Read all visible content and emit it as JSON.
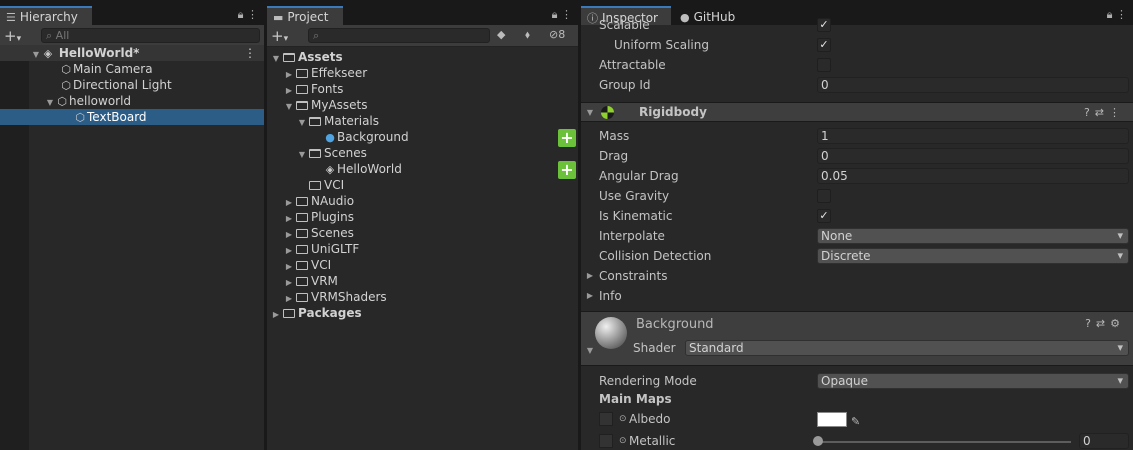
{
  "hierarchy": {
    "tab_label": "Hierarchy",
    "search_placeholder": "All",
    "scene_name": "HelloWorld*",
    "items": [
      {
        "label": "Main Camera"
      },
      {
        "label": "Directional Light"
      },
      {
        "label": "helloworld"
      },
      {
        "label": "TextBoard"
      }
    ]
  },
  "project": {
    "tab_label": "Project",
    "hidden_count": "8",
    "tree": [
      {
        "label": "Assets"
      },
      {
        "label": "Effekseer"
      },
      {
        "label": "Fonts"
      },
      {
        "label": "MyAssets"
      },
      {
        "label": "Materials"
      },
      {
        "label": "Background"
      },
      {
        "label": "Scenes"
      },
      {
        "label": "HelloWorld"
      },
      {
        "label": "VCI"
      },
      {
        "label": "NAudio"
      },
      {
        "label": "Plugins"
      },
      {
        "label": "Scenes"
      },
      {
        "label": "UniGLTF"
      },
      {
        "label": "VCI"
      },
      {
        "label": "VRM"
      },
      {
        "label": "VRMShaders"
      },
      {
        "label": "Packages"
      }
    ]
  },
  "inspector": {
    "tab_label": "Inspector",
    "github_tab_label": "GitHub",
    "top_rows": {
      "scalable": "Scalable",
      "uniform_scaling": "Uniform Scaling",
      "attractable": "Attractable",
      "group_id": "Group Id",
      "group_id_value": "0"
    },
    "rigidbody": {
      "title": "Rigidbody",
      "mass_label": "Mass",
      "mass_value": "1",
      "drag_label": "Drag",
      "drag_value": "0",
      "angular_drag_label": "Angular Drag",
      "angular_drag_value": "0.05",
      "use_gravity_label": "Use Gravity",
      "is_kinematic_label": "Is Kinematic",
      "interpolate_label": "Interpolate",
      "interpolate_value": "None",
      "collision_label": "Collision Detection",
      "collision_value": "Discrete",
      "constraints_label": "Constraints",
      "info_label": "Info"
    },
    "material": {
      "name": "Background",
      "shader_label": "Shader",
      "shader_value": "Standard",
      "rendering_mode_label": "Rendering Mode",
      "rendering_mode_value": "Opaque",
      "main_maps_label": "Main Maps",
      "albedo_label": "Albedo",
      "metallic_label": "Metallic",
      "metallic_value": "0"
    }
  }
}
